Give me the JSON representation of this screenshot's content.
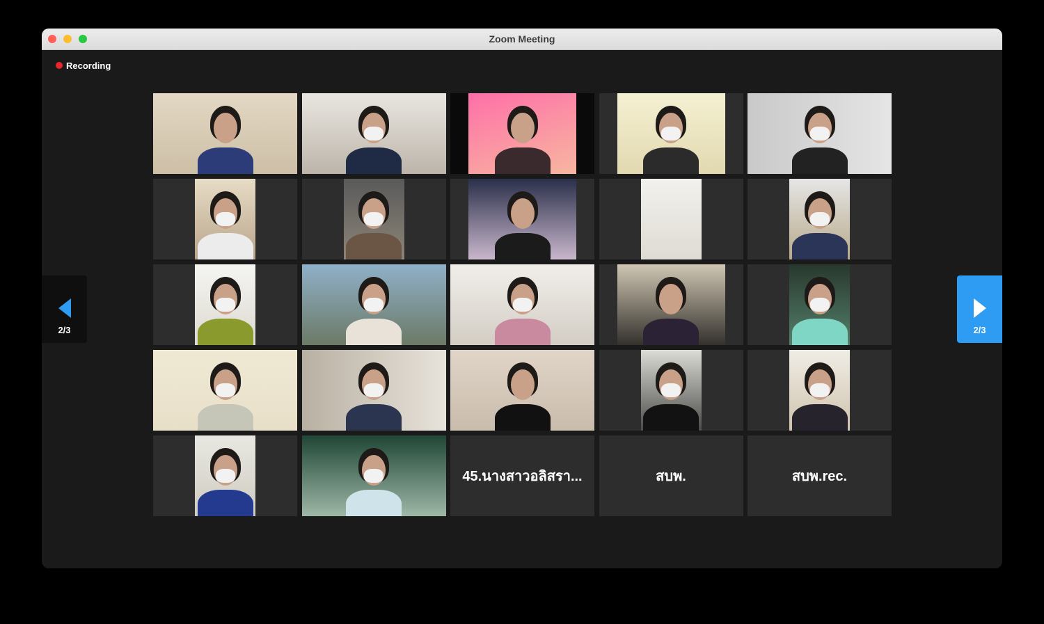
{
  "window": {
    "title": "Zoom Meeting"
  },
  "recording": {
    "label": "Recording",
    "color": "#e8262b"
  },
  "pagination": {
    "current": "2/3"
  },
  "colors": {
    "accent": "#2d9cf2",
    "tile_bg": "#2d2d2d",
    "window_bg": "#1a1a1a"
  },
  "participants": [
    {
      "type": "video"
    },
    {
      "type": "video"
    },
    {
      "type": "video"
    },
    {
      "type": "video"
    },
    {
      "type": "video"
    },
    {
      "type": "video"
    },
    {
      "type": "video"
    },
    {
      "type": "video"
    },
    {
      "type": "video"
    },
    {
      "type": "video"
    },
    {
      "type": "video"
    },
    {
      "type": "video"
    },
    {
      "type": "video"
    },
    {
      "type": "video"
    },
    {
      "type": "video"
    },
    {
      "type": "video"
    },
    {
      "type": "video"
    },
    {
      "type": "video"
    },
    {
      "type": "video"
    },
    {
      "type": "video"
    },
    {
      "type": "video"
    },
    {
      "type": "video"
    },
    {
      "type": "name",
      "name": "45.นางสาวอลิสรา..."
    },
    {
      "type": "name",
      "name": "สบพ."
    },
    {
      "type": "name",
      "name": "สบพ.rec."
    }
  ]
}
